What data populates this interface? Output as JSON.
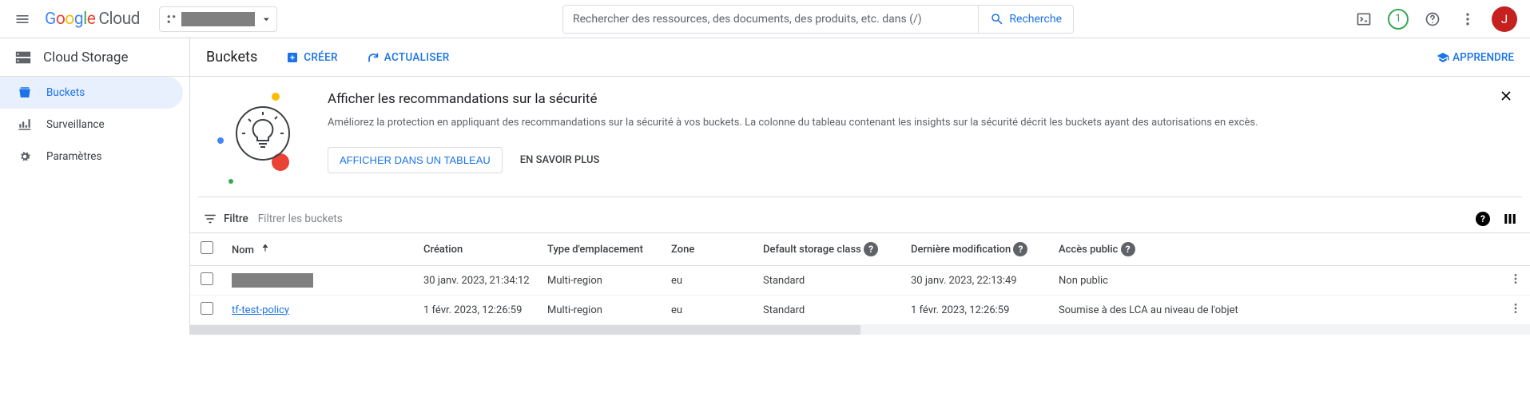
{
  "header": {
    "logo_text": "Google",
    "logo_suffix": "Cloud",
    "search_placeholder": "Rechercher des ressources, des documents, des produits, etc. dans (/)",
    "search_button": "Recherche",
    "trial_badge": "1",
    "avatar_letter": "J"
  },
  "sidebar": {
    "service": "Cloud Storage",
    "items": [
      {
        "label": "Buckets"
      },
      {
        "label": "Surveillance"
      },
      {
        "label": "Paramètres"
      }
    ]
  },
  "page": {
    "title": "Buckets",
    "create": "CRÉER",
    "refresh": "ACTUALISER",
    "learn": "APPRENDRE"
  },
  "banner": {
    "title": "Afficher les recommandations sur la sécurité",
    "text": "Améliorez la protection en appliquant des recommandations sur la sécurité à vos buckets. La colonne du tableau contenant les insights sur la sécurité décrit les buckets ayant des autorisations en excès.",
    "primary": "AFFICHER DANS UN TABLEAU",
    "secondary": "EN SAVOIR PLUS"
  },
  "filter": {
    "label": "Filtre",
    "placeholder": "Filtrer les buckets"
  },
  "table": {
    "columns": {
      "name": "Nom",
      "created": "Création",
      "location_type": "Type d'emplacement",
      "zone": "Zone",
      "storage_class": "Default storage class",
      "modified": "Dernière modification",
      "public_access": "Accès public"
    },
    "rows": [
      {
        "name": "",
        "redacted": true,
        "created": "30 janv. 2023, 21:34:12",
        "location_type": "Multi-region",
        "zone": "eu",
        "storage_class": "Standard",
        "modified": "30 janv. 2023, 22:13:49",
        "public_access": "Non public"
      },
      {
        "name": "tf-test-policy",
        "redacted": false,
        "created": "1 févr. 2023, 12:26:59",
        "location_type": "Multi-region",
        "zone": "eu",
        "storage_class": "Standard",
        "modified": "1 févr. 2023, 12:26:59",
        "public_access": "Soumise à des LCA au niveau de l'objet"
      }
    ]
  }
}
